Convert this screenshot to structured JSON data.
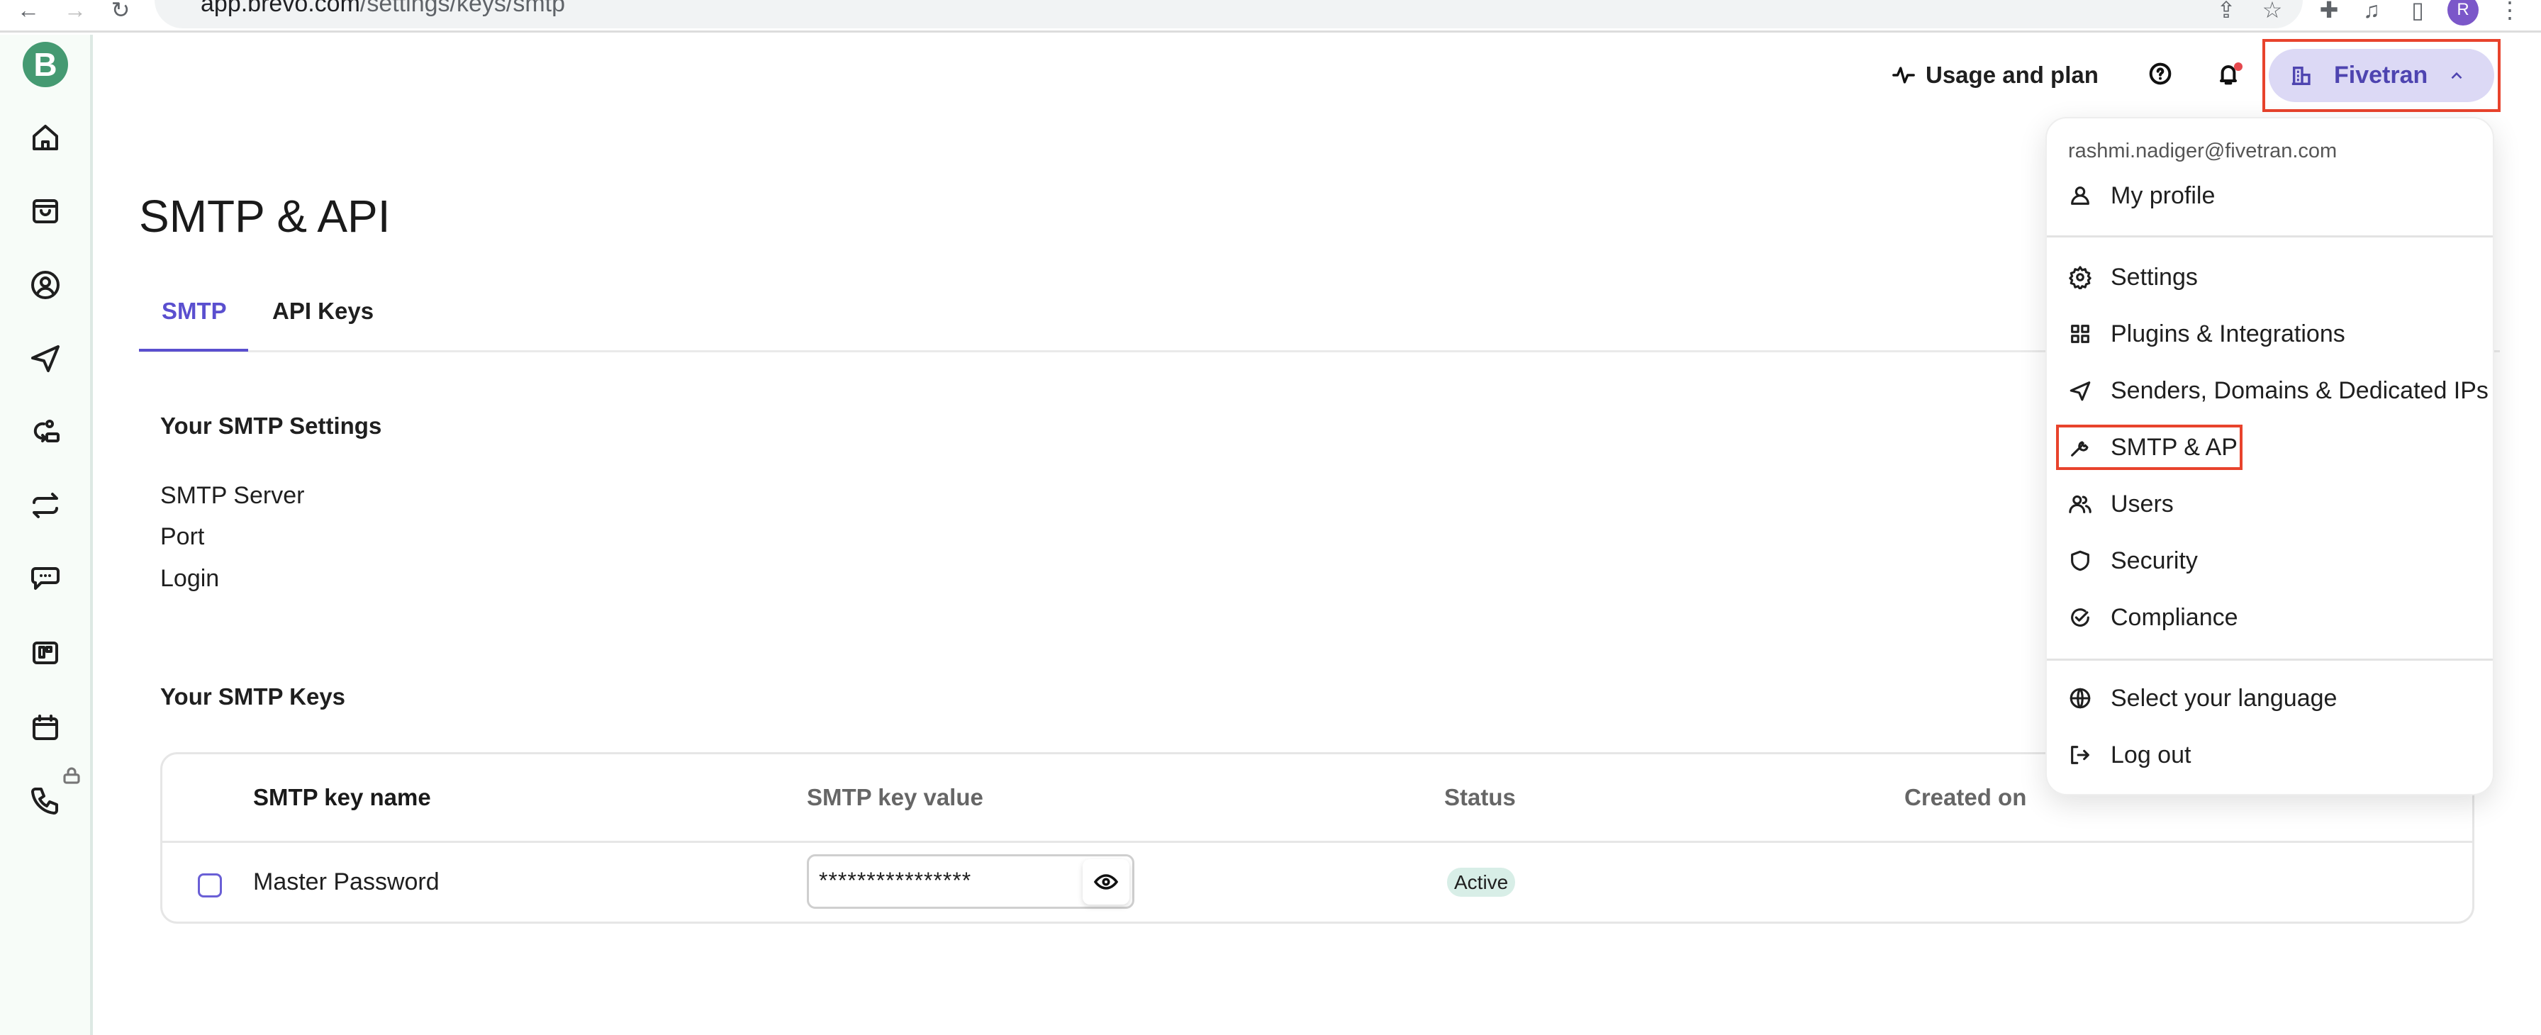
{
  "browser": {
    "url_host": "app.brevo.com",
    "url_path": "/settings/keys/smtp",
    "avatar_letter": "R"
  },
  "sidebar": {
    "logo": "B",
    "items": [
      {
        "icon": "home-icon"
      },
      {
        "icon": "shopping-bag-icon"
      },
      {
        "icon": "contacts-icon"
      },
      {
        "icon": "send-icon"
      },
      {
        "icon": "automation-icon"
      },
      {
        "icon": "transactional-icon"
      },
      {
        "icon": "conversations-icon"
      },
      {
        "icon": "deals-icon"
      },
      {
        "icon": "calendar-icon"
      },
      {
        "icon": "phone-icon",
        "locked": true
      }
    ]
  },
  "header": {
    "usage_label": "Usage and plan",
    "org_name": "Fivetran"
  },
  "page": {
    "title": "SMTP & API",
    "tabs": [
      {
        "label": "SMTP",
        "active": true
      },
      {
        "label": "API Keys",
        "active": false
      }
    ]
  },
  "settings": {
    "heading": "Your SMTP Settings",
    "fields": [
      "SMTP Server",
      "Port",
      "Login"
    ]
  },
  "keys": {
    "heading": "Your SMTP Keys",
    "columns": [
      "SMTP key name",
      "SMTP key value",
      "Status",
      "Created on"
    ],
    "rows": [
      {
        "name": "Master Password",
        "value": "****************",
        "status": "Active",
        "created_on": ""
      }
    ]
  },
  "menu": {
    "email": "rashmi.nadiger@fivetran.com",
    "profile": "My profile",
    "items": [
      "Settings",
      "Plugins & Integrations",
      "Senders, Domains & Dedicated IPs",
      "SMTP & API",
      "Users",
      "Security",
      "Compliance"
    ],
    "language": "Select your language",
    "logout": "Log out"
  },
  "colors": {
    "accent": "#5a4fcf",
    "brand": "#459a72",
    "highlight": "#e8432c",
    "active_badge": "#d8eee7"
  }
}
